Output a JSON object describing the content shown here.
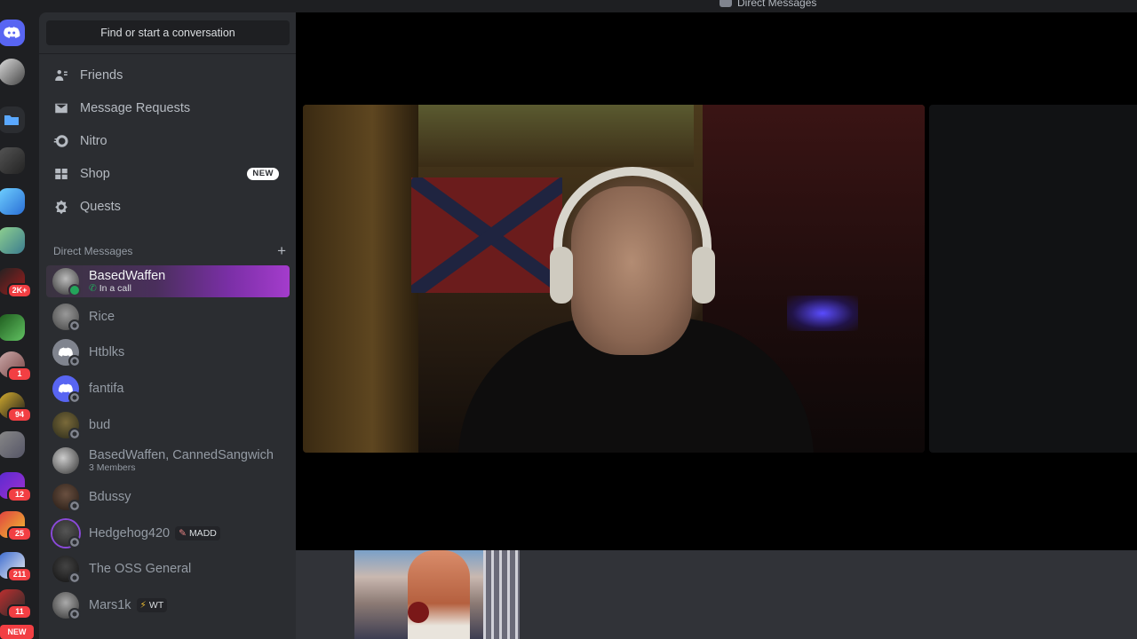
{
  "window": {
    "title": "Direct Messages"
  },
  "search": {
    "label": "Find or start a conversation"
  },
  "nav": [
    {
      "label": "Friends",
      "icon": "friends-icon"
    },
    {
      "label": "Message Requests",
      "icon": "envelope-icon"
    },
    {
      "label": "Nitro",
      "icon": "nitro-icon"
    },
    {
      "label": "Shop",
      "icon": "shop-icon",
      "badge": "NEW"
    },
    {
      "label": "Quests",
      "icon": "quests-icon"
    }
  ],
  "dm_section": {
    "title": "Direct Messages",
    "add": "+"
  },
  "dms": [
    {
      "name": "BasedWaffen",
      "sub": "In a call",
      "active": true
    },
    {
      "name": "Rice"
    },
    {
      "name": "Htblks"
    },
    {
      "name": "fantifa"
    },
    {
      "name": "bud"
    },
    {
      "name": "BasedWaffen, CannedSangwich",
      "sub": "3 Members"
    },
    {
      "name": "Bdussy"
    },
    {
      "name": "Hedgehog420",
      "tag": "MADD"
    },
    {
      "name": "The OSS General"
    },
    {
      "name": "Mars1k",
      "tag": "WT"
    }
  ],
  "servers": [
    {
      "badge": ""
    },
    {
      "badge": ""
    },
    {
      "badge": ""
    },
    {
      "badge": ""
    },
    {
      "badge": ""
    },
    {
      "badge": ""
    },
    {
      "badge": "2K+"
    },
    {
      "badge": ""
    },
    {
      "badge": "1"
    },
    {
      "badge": "94"
    },
    {
      "badge": ""
    },
    {
      "badge": "12"
    },
    {
      "badge": "25"
    },
    {
      "badge": "211"
    },
    {
      "badge": "11"
    }
  ],
  "rail_new": "NEW",
  "colors": {
    "accent": "#5865f2",
    "online": "#23a55a",
    "badge": "#f23f43",
    "sidebar": "#2b2d31"
  }
}
